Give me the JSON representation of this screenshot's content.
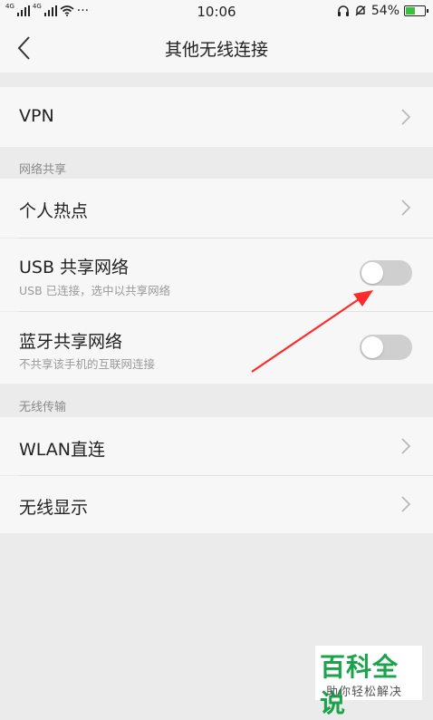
{
  "status_bar": {
    "network1": "4G",
    "network2": "4G",
    "dots": "···",
    "time": "10:06",
    "battery": "54%",
    "battery_level": 0.54
  },
  "header": {
    "title": "其他无线连接"
  },
  "rows": {
    "vpn": {
      "label": "VPN"
    },
    "hotspot": {
      "label": "个人热点"
    },
    "usb": {
      "label": "USB 共享网络",
      "sub": "USB 已连接，选中以共享网络",
      "on": false
    },
    "bluetooth": {
      "label": "蓝牙共享网络",
      "sub": "不共享该手机的互联网连接",
      "on": false
    },
    "wlan_direct": {
      "label": "WLAN直连"
    },
    "wireless_display": {
      "label": "无线显示"
    }
  },
  "sections": {
    "sharing": "网络共享",
    "transfer": "无线传输"
  },
  "watermark": {
    "brand": "百科全说",
    "slogan": "助你轻松解决"
  },
  "colors": {
    "arrow": "#ff2a2a",
    "battery_fill": "#3cbf3c",
    "watermark_green": "#1aa34a"
  }
}
